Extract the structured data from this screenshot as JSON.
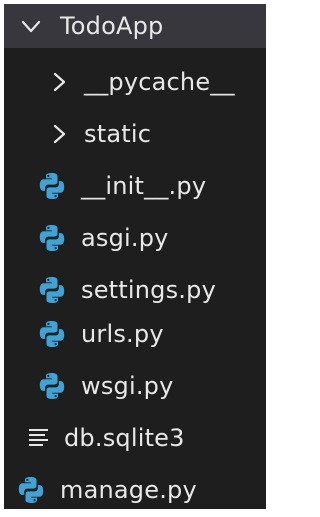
{
  "colors": {
    "background": "#1e1e1e",
    "selected_row": "#37373d",
    "text": "#e8e8e8",
    "python_blue": "#3fa3d6",
    "python_yellow": "#3fa3d6"
  },
  "explorer": {
    "root": {
      "label": "TodoApp",
      "expanded": true,
      "icon": "chevron-down-icon"
    },
    "folders": [
      {
        "label": "__pycache__",
        "expanded": false,
        "icon": "chevron-right-icon"
      },
      {
        "label": "static",
        "expanded": false,
        "icon": "chevron-right-icon"
      }
    ],
    "files": [
      {
        "label": "__init__.py",
        "icon": "python-file-icon"
      },
      {
        "label": "asgi.py",
        "icon": "python-file-icon"
      },
      {
        "label": "settings.py",
        "icon": "python-file-icon"
      },
      {
        "label": "urls.py",
        "icon": "python-file-icon"
      },
      {
        "label": "wsgi.py",
        "icon": "python-file-icon"
      }
    ],
    "root_files": [
      {
        "label": "db.sqlite3",
        "icon": "lines-file-icon"
      },
      {
        "label": "manage.py",
        "icon": "python-file-icon"
      }
    ]
  }
}
